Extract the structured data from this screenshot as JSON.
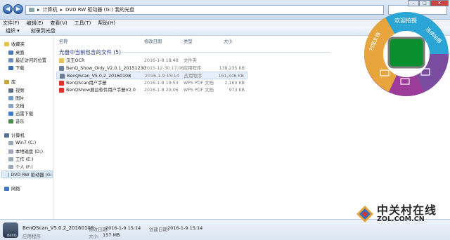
{
  "address": {
    "segments": [
      "计算机",
      "DVD RW 驱动器 (G:) 我的光盘"
    ]
  },
  "window_buttons": {
    "minimize": "–",
    "maximize": "□",
    "close": "✕"
  },
  "menu": [
    "文件(F)",
    "编辑(E)",
    "查看(V)",
    "工具(T)",
    "帮助(H)"
  ],
  "toolbar": [
    "组织 ▾",
    "刻录到光盘"
  ],
  "sidebar": {
    "favorites": "收藏夹",
    "fav_items": [
      "桌面",
      "最近访问的位置",
      "下载"
    ],
    "libraries": "库",
    "lib_items": [
      "视频",
      "图片",
      "文档",
      "迅雷下载",
      "音乐"
    ],
    "computer": "计算机",
    "drives": [
      "Win7 (C:)",
      "本地磁盘 (D:)",
      "工作 (E:)",
      "个人 (F:)",
      "DVD RW 驱动器 (G:"
    ],
    "network": "网络"
  },
  "columns": {
    "name": "名称",
    "date": "修改日期",
    "type": "类型",
    "size": "大小"
  },
  "group_header": "光盘中当前包含的文件 (5)",
  "files": [
    {
      "name": "汉王OCR",
      "date": "2016-1-8 18:48",
      "type": "文件夹",
      "size": "",
      "icon": "folder-icon",
      "icon_color": "#e8c25a"
    },
    {
      "name": "BenQ_Show_Only_V2.0.1_20151230",
      "date": "2015-12-30 17:06",
      "type": "应用程序",
      "size": "138,235 KB",
      "icon": "app-icon",
      "icon_color": "#6b7f9c"
    },
    {
      "name": "BenQScan_V5.0.2_20160108",
      "date": "2016-1-9 15:14",
      "type": "应用程序",
      "size": "161,346 KB",
      "icon": "app-icon",
      "icon_color": "#6b7f9c"
    },
    {
      "name": "BenQScan用户手册",
      "date": "2016-1-8 19:53",
      "type": "WPS PDF 文档",
      "size": "2,160 KB",
      "icon": "pdf-icon",
      "icon_color": "#d9332b"
    },
    {
      "name": "BenQShow展台软件用户手册V2.0",
      "date": "2016-1-8 20:06",
      "type": "WPS PDF 文档",
      "size": "973 KB",
      "icon": "pdf-icon",
      "icon_color": "#d9332b"
    }
  ],
  "selected_file_index": 2,
  "status": {
    "name": "BenQScan_V5.0.2_20160108",
    "modified_label": "修改日期:",
    "modified": "2016-1-9 15:14",
    "created_label": "创建日期:",
    "created": "2016-1-9 15:14",
    "type": "应用程序",
    "size_label": "大小:",
    "size": "157 MB",
    "brand": "BenQ"
  },
  "widget": {
    "labels": [
      "欢迎拍摄",
      "连续拍摄",
      "扫描文档"
    ],
    "center_color": "#0a8f2e",
    "ring_colors": [
      "#2aa5d6",
      "#e8a53d",
      "#9c3b9a",
      "#7a4ca0"
    ]
  },
  "watermark": {
    "title": "中关村在线",
    "url": "ZOL.COM.CN"
  }
}
